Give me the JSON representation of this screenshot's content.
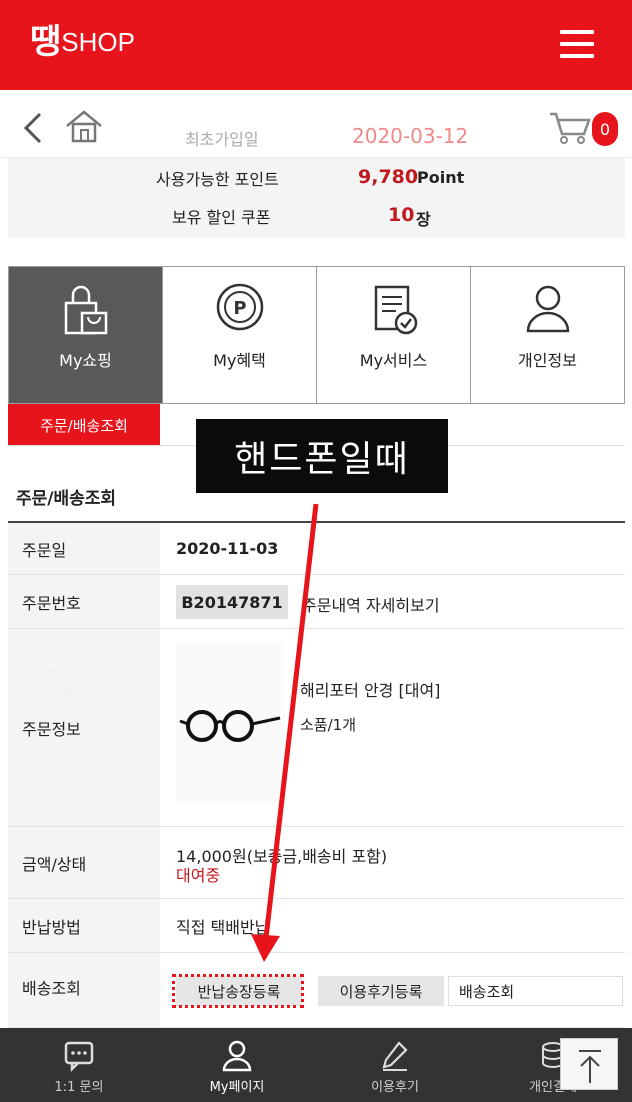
{
  "header": {
    "logo_mark": "땡",
    "logo_text": "SHOP"
  },
  "member": {
    "join_label": "최초가입일",
    "join_date": "2020-03-12",
    "cart_count": "0"
  },
  "benefits": {
    "points_label": "사용가능한 포인트",
    "points_value": "9,780",
    "points_unit": "Point",
    "coupon_label": "보유 할인 쿠폰",
    "coupon_value": "10",
    "coupon_unit": "장"
  },
  "tabs": [
    {
      "label": "My쇼핑",
      "icon": "shopping-bag-icon",
      "active": true
    },
    {
      "label": "My혜택",
      "icon": "point-coin-icon",
      "active": false
    },
    {
      "label": "My서비스",
      "icon": "service-document-icon",
      "active": false
    },
    {
      "label": "개인정보",
      "icon": "person-icon",
      "active": false
    }
  ],
  "subtab": {
    "label": "주문/배송조회"
  },
  "order": {
    "section_title": "주문/배송조회",
    "date_label": "주문일",
    "date_value": "2020-11-03",
    "number_label": "주문번호",
    "number_value": "B20147871",
    "detail_link": "주문내역 자세히보기",
    "info_label": "주문정보",
    "product_name": "해리포터 안경 [대여]",
    "product_qty": "소품/1개",
    "amount_label": "금액/상태",
    "amount_value": "14,000원(보증금,배송비 포함)",
    "status_value": "대여중",
    "return_label": "반납방법",
    "return_value": "직접 택배반납",
    "delivery_label": "배송조회",
    "buttons": [
      "반납송장등록",
      "이용후기등록",
      "배송조회"
    ]
  },
  "annotation": {
    "callout_text": "핸드폰일때",
    "accent_color": "#e8141b"
  },
  "bottom_nav": [
    {
      "label": "1:1 문의",
      "icon": "chat-icon"
    },
    {
      "label": "My페이지",
      "icon": "person-icon"
    },
    {
      "label": "이용후기",
      "icon": "pencil-icon"
    },
    {
      "label": "개인결제",
      "icon": "coins-icon"
    }
  ],
  "totop": {
    "icon": "arrow-up-icon"
  }
}
